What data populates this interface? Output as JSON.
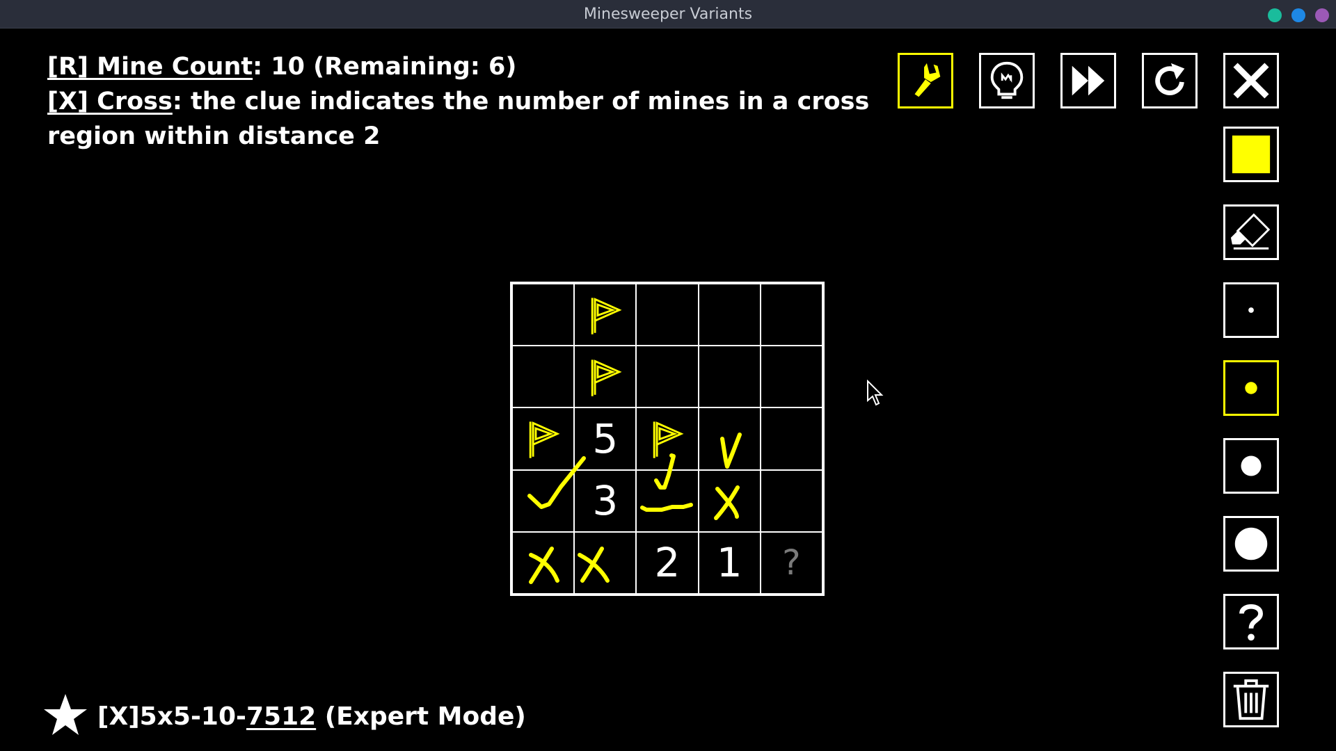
{
  "window": {
    "title": "Minesweeper Variants",
    "buttons": {
      "min_color": "#1abc9c",
      "max_color": "#1e88e5",
      "close_color": "#9b59b6"
    }
  },
  "rules": {
    "r_tag": "[R] Mine Count",
    "r_text": ":  10 (Remaining: 6)",
    "x_tag": "[X] Cross",
    "x_text": ": the clue indicates the number of mines in a cross",
    "x_text2": "region within distance 2"
  },
  "board": {
    "rows": [
      [
        "",
        "flag",
        "",
        "",
        ""
      ],
      [
        "",
        "flag",
        "",
        "",
        ""
      ],
      [
        "flag",
        "5",
        "flag",
        "",
        ""
      ],
      [
        "",
        "3",
        "",
        "",
        ""
      ],
      [
        "",
        "",
        "2",
        "1",
        "?"
      ]
    ],
    "accent": "#ffff00"
  },
  "toolbar": {
    "top": [
      {
        "name": "brush-tool-button",
        "icon": "brush-icon",
        "active": true
      },
      {
        "name": "hint-button",
        "icon": "lightbulb-icon",
        "active": false
      },
      {
        "name": "skip-button",
        "icon": "fast-forward-icon",
        "active": false
      },
      {
        "name": "restart-button",
        "icon": "refresh-icon",
        "active": false
      },
      {
        "name": "close-button",
        "icon": "close-icon",
        "active": false
      }
    ],
    "side": [
      {
        "name": "color-fill-button",
        "icon": "yellow-square-icon"
      },
      {
        "name": "eraser-button",
        "icon": "eraser-icon"
      },
      {
        "name": "pen-size-tiny-button",
        "icon": "dot-tiny-icon"
      },
      {
        "name": "pen-size-small-button",
        "icon": "dot-small-icon",
        "active": true
      },
      {
        "name": "pen-size-medium-button",
        "icon": "dot-medium-icon"
      },
      {
        "name": "pen-size-large-button",
        "icon": "dot-large-icon"
      },
      {
        "name": "unknown-mark-button",
        "icon": "question-icon"
      },
      {
        "name": "clear-button",
        "icon": "trash-icon"
      }
    ]
  },
  "footer": {
    "prefix": "[X]5x5-10-",
    "seed": "7512",
    "mode": " (Expert Mode)"
  }
}
